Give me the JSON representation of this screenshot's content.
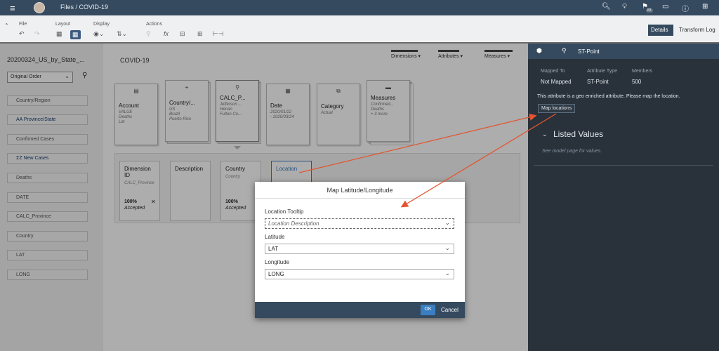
{
  "shell": {
    "breadcrumb": "Files  /  COVID-19",
    "badge": "83"
  },
  "toolbar": {
    "groups": [
      {
        "label": "File"
      },
      {
        "label": "Layout"
      },
      {
        "label": "Display"
      },
      {
        "label": "Actions"
      }
    ],
    "details_tab": "Details",
    "transform_tab": "Transform Log"
  },
  "left": {
    "title": "20200324_US_by_State_...",
    "order_select": "Original Order",
    "items": [
      {
        "label": "Country/Region"
      },
      {
        "label": "AA  Province/State"
      },
      {
        "label": "Confirmed Cases"
      },
      {
        "label": "ΣZ  New Cases"
      },
      {
        "label": "Deaths"
      },
      {
        "label": "DATE"
      },
      {
        "label": "CALC_Province"
      },
      {
        "label": "Country"
      },
      {
        "label": "LAT"
      },
      {
        "label": "LONG"
      }
    ]
  },
  "main": {
    "title": "COVID-19",
    "filters": {
      "dimensions": "Dimensions ▾",
      "attributes": "Attributes ▾",
      "measures": "Measures ▾"
    },
    "cards": [
      {
        "name": "Account",
        "values": "VALUE\nDeaths\nLat"
      },
      {
        "name": "Country/...",
        "values": "US\nBrazil\nPuerto Rico"
      },
      {
        "name": "CALC_P...",
        "values": "Jefferson ...\nHenan\nFulton Co..."
      },
      {
        "name": "Date",
        "values": "2020/01/22\n- 2020/03/24"
      },
      {
        "name": "Category",
        "values": "Actual"
      },
      {
        "name": "Measures",
        "values": "Confirmed...\nDeaths\n+ 3 more"
      }
    ],
    "attrs": [
      {
        "name": "Dimension ID",
        "sub": "CALC_Province",
        "pct": "100%",
        "status": "Accepted"
      },
      {
        "name": "Description",
        "sub": "",
        "pct": "",
        "status": ""
      },
      {
        "name": "Country",
        "sub": "Country",
        "pct": "100%",
        "status": "Accepted"
      },
      {
        "name": "Location",
        "sub": "",
        "pct": "",
        "status": ""
      }
    ]
  },
  "right": {
    "tab_label": "ST-Point",
    "mapped_to_label": "Mapped To",
    "mapped_to_value": "Not Mapped",
    "attr_type_label": "Attribute Type",
    "attr_type_value": "ST-Point",
    "members_label": "Members",
    "members_value": "500",
    "message": "This attribute is a geo enriched attribute. Please map the location.",
    "map_button": "Map locations",
    "listed_values": "Listed Values",
    "see_model": "See model page for values."
  },
  "dialog": {
    "title": "Map Latitude/Longitude",
    "tooltip_label": "Location Tooltip",
    "tooltip_placeholder": "Location Description",
    "lat_label": "Latitude",
    "lat_value": "LAT",
    "long_label": "Longitude",
    "long_value": "LONG",
    "ok": "OK",
    "cancel": "Cancel"
  },
  "colors": {
    "shell": "#354a5f",
    "accent": "#3a7ec1",
    "arrow": "#e2552f",
    "right_panel": "#29313a"
  }
}
